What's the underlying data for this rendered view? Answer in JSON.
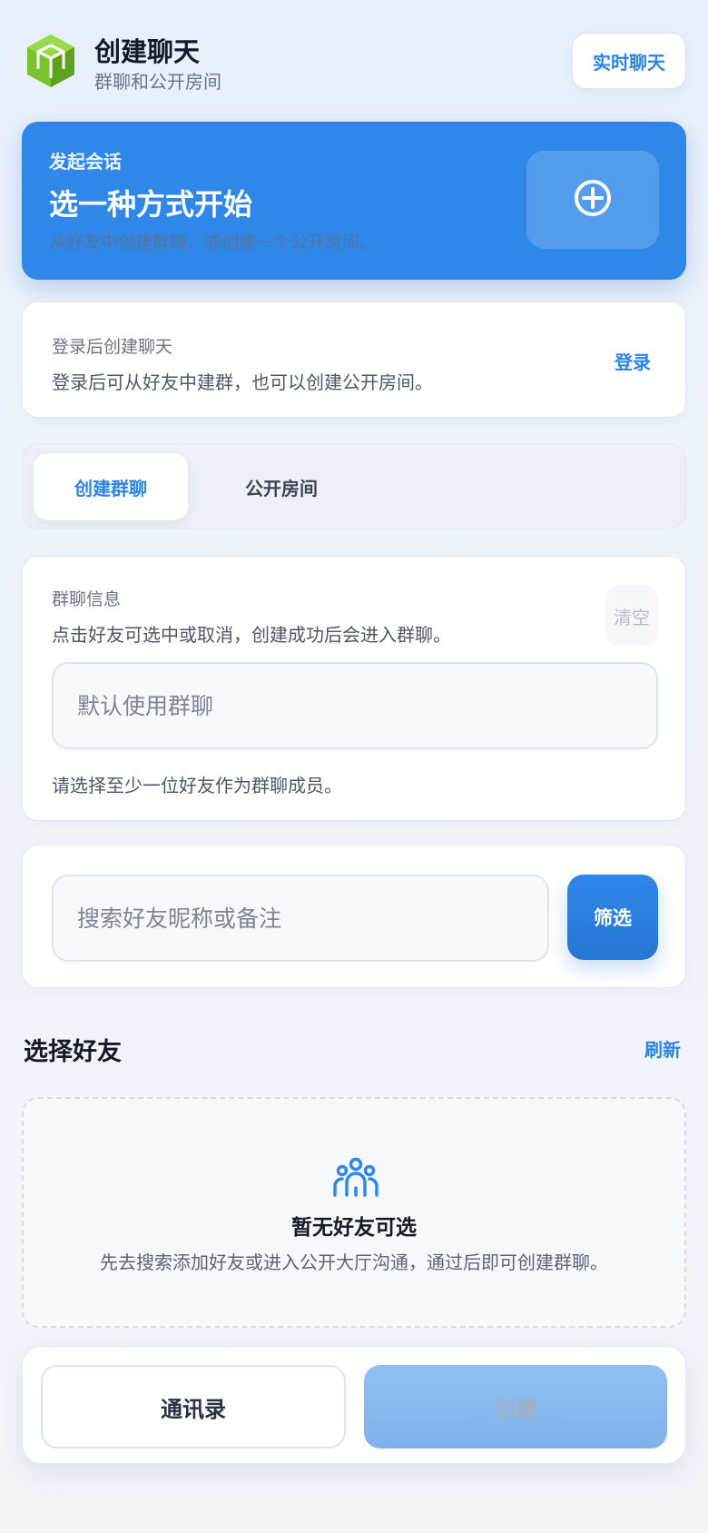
{
  "header": {
    "title": "创建聊天",
    "subtitle": "群聊和公开房间",
    "live_chat_label": "实时聊天",
    "logo_icon": "green-cube-icon"
  },
  "hero": {
    "kicker": "发起会话",
    "title": "选一种方式开始",
    "description": "从好友中创建群聊，或创建一个公开房间。",
    "action_icon": "plus-circle-icon"
  },
  "login": {
    "title": "登录后创建聊天",
    "description": "登录后可从好友中建群，也可以创建公开房间。",
    "button": "登录"
  },
  "tabs": [
    {
      "label": "创建群聊",
      "active": true
    },
    {
      "label": "公开房间",
      "active": false
    }
  ],
  "group": {
    "title": "群聊信息",
    "description": "点击好友可选中或取消，创建成功后会进入群聊。",
    "clear_label": "清空",
    "name_placeholder": "默认使用群聊",
    "name_value": "",
    "hint": "请选择至少一位好友作为群聊成员。"
  },
  "search": {
    "placeholder": "搜索好友昵称或备注",
    "value": "",
    "filter_label": "筛选"
  },
  "friends": {
    "title": "选择好友",
    "refresh_label": "刷新",
    "empty_icon": "users-icon",
    "empty_title": "暂无好友可选",
    "empty_description": "先去搜索添加好友或进入公开大厅沟通，通过后即可创建群聊。"
  },
  "footer": {
    "contacts_label": "通讯录",
    "create_label": "创建"
  },
  "colors": {
    "accent": "#2f87e8",
    "logo_green": "#7cc230"
  }
}
